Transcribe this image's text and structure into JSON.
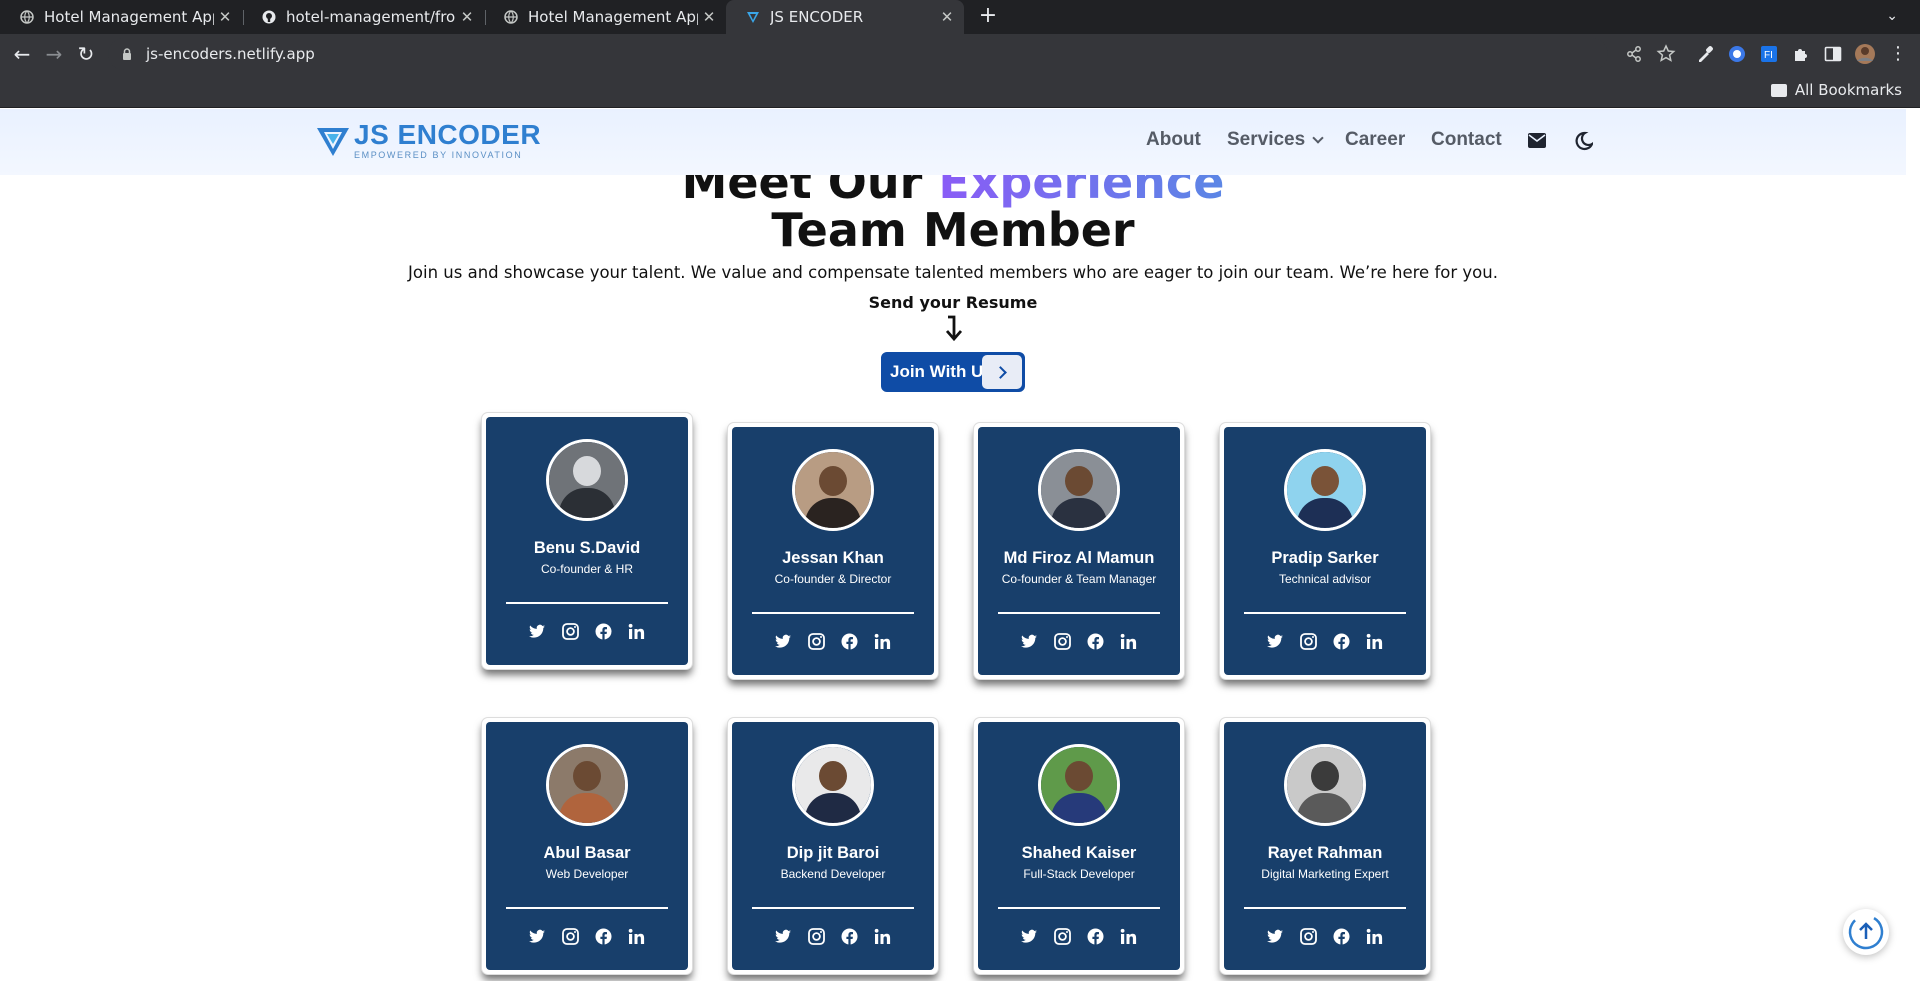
{
  "browser": {
    "tabs": [
      {
        "title": "Hotel Management Appli",
        "icon": "globe-icon"
      },
      {
        "title": "hotel-management/front",
        "icon": "github-icon"
      },
      {
        "title": "Hotel Management Appli",
        "icon": "globe-icon"
      },
      {
        "title": "JS ENCODER",
        "icon": "js-encoder-icon"
      }
    ],
    "url": "js-encoders.netlify.app",
    "bookmarks_label": "All Bookmarks"
  },
  "site": {
    "brand": "JS ENCODER",
    "tagline": "EMPOWERED BY INNOVATION",
    "nav": {
      "about": "About",
      "services": "Services",
      "career": "Career",
      "contact": "Contact"
    }
  },
  "hero": {
    "title_part1": "Meet Our ",
    "title_accent": "Experience",
    "title_line2": "Team Member",
    "subtitle": "Join us and showcase your talent. We value and compensate talented members who are eager to join our team. We’re here for you.",
    "send_label": "Send your Resume",
    "join_button": "Join With Us"
  },
  "team": [
    {
      "name": "Benu S.David",
      "role": "Co-founder & HR"
    },
    {
      "name": "Jessan Khan",
      "role": "Co-founder & Director"
    },
    {
      "name": "Md Firoz Al Mamun",
      "role": "Co-founder & Team Manager"
    },
    {
      "name": "Pradip Sarker",
      "role": "Technical advisor"
    },
    {
      "name": "Abul Basar",
      "role": "Web Developer"
    },
    {
      "name": "Dip jit Baroi",
      "role": "Backend Developer"
    },
    {
      "name": "Shahed Kaiser",
      "role": "Full-Stack Developer"
    },
    {
      "name": "Rayet Rahman",
      "role": "Digital Marketing Expert"
    }
  ],
  "colors": {
    "card_bg": "#183f6b",
    "join_button": "#0f4ca6",
    "brand_blue": "#2f7fd0",
    "accent_gradient_start": "#8a5cf6",
    "accent_gradient_end": "#5b86e5"
  }
}
